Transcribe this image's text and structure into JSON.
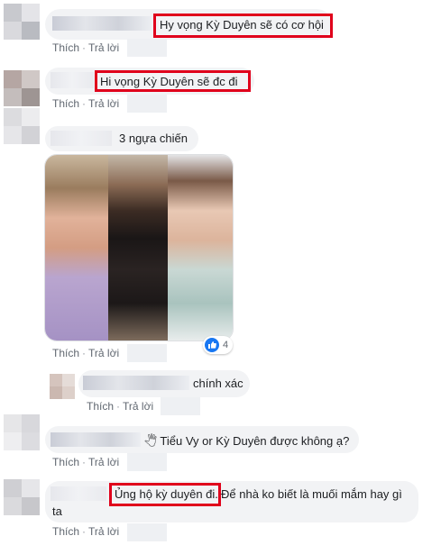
{
  "comments": [
    {
      "text": "Hy vọng Kỳ Duyên sẽ có cơ hội",
      "like": "Thích",
      "reply": "Trả lời"
    },
    {
      "text": "Hi vọng Kỳ Duyên sẽ đc đi",
      "like": "Thích",
      "reply": "Trả lời"
    },
    {
      "text": "3 ngựa chiến",
      "like": "Thích",
      "reply": "Trả lời",
      "reaction_count": "4"
    },
    {
      "text": "chính xác",
      "like": "Thích",
      "reply": "Trả lời"
    },
    {
      "text": "🖑 Tiểu Vy or Kỳ Duyên được không ạ?",
      "like": "Thích",
      "reply": "Trả lời"
    },
    {
      "text_highlight": "Ủng hộ kỳ duyên đi.",
      "text_rest": " Để nhà ko biết là muối mắm hay gì",
      "text_line2": "ta",
      "like": "Thích",
      "reply": "Trả lời"
    }
  ],
  "icons": {
    "reaction": "like-icon"
  },
  "colors": {
    "highlight": "#e0001b",
    "bubble": "#f2f3f5",
    "like_blue": "#1877f2"
  }
}
